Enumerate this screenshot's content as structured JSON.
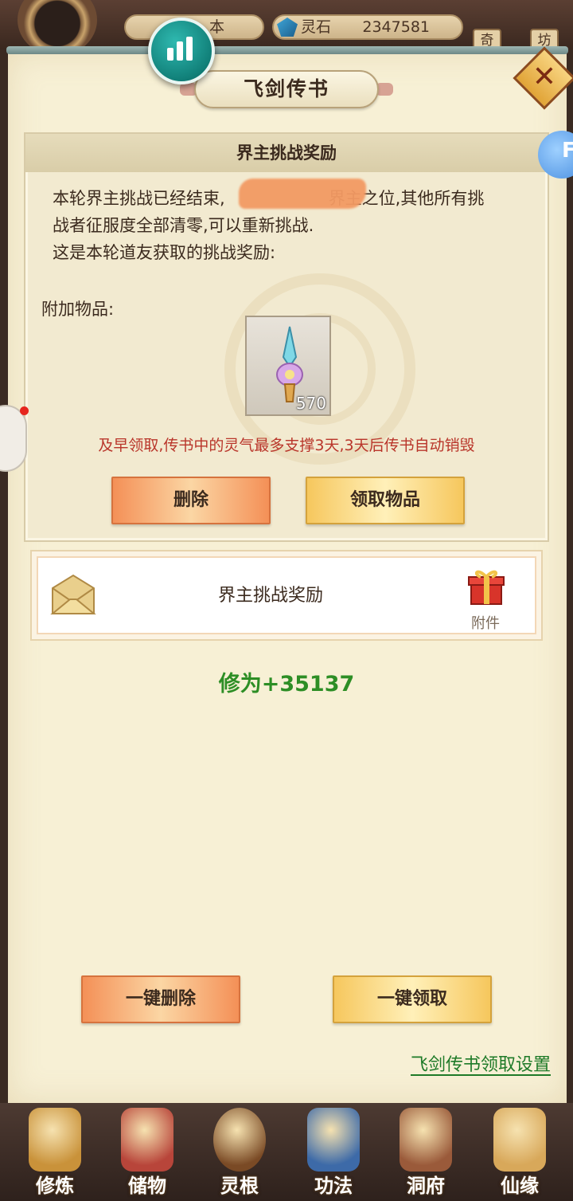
{
  "hud": {
    "left_resource_label": "本",
    "spirit_stone_label": "灵石",
    "spirit_stone_value": "2347581",
    "corner_buttons": [
      "奇",
      "坊"
    ]
  },
  "window": {
    "title": "飞剑传书",
    "close_label": "✕"
  },
  "mail_detail": {
    "header": "界主挑战奖励",
    "body_line1_pre": "本轮界主挑战已经结束,",
    "body_line1_post": "界主之位,其他所有挑",
    "body_line2": "战者征服度全部清零,可以重新挑战.",
    "body_line3": "这是本轮道友获取的挑战奖励:",
    "attachment_label": "附加物品:",
    "item_count": "570",
    "warning": "及早领取,传书中的灵气最多支撑3天,3天后传书自动销毁",
    "delete_button": "删除",
    "claim_button": "领取物品"
  },
  "mail_list": [
    {
      "title": "界主挑战奖励",
      "tag": "附件"
    }
  ],
  "exp_gain": "修为+35137",
  "bulk_actions": {
    "delete_all": "一键删除",
    "claim_all": "一键领取"
  },
  "settings_link": "飞剑传书领取设置",
  "side_bubble_letter": "F",
  "bottom_nav": [
    {
      "label": "修炼",
      "icon": "cultivation-icon",
      "color": "#c9923a"
    },
    {
      "label": "储物",
      "icon": "storage-bag-icon",
      "color": "#b8453a"
    },
    {
      "label": "灵根",
      "icon": "spirit-root-icon",
      "color": "#7a4a25"
    },
    {
      "label": "功法",
      "icon": "technique-book-icon",
      "color": "#3d6aa8"
    },
    {
      "label": "洞府",
      "icon": "cave-residence-icon",
      "color": "#9a5a3a"
    },
    {
      "label": "仙缘",
      "icon": "immortal-fate-icon",
      "color": "#d8a85a"
    }
  ],
  "colors": {
    "warning_red": "#b9352a",
    "exp_green": "#2d8e25",
    "link_green": "#1e7a28",
    "panel_bg": "#f7f0d5"
  }
}
